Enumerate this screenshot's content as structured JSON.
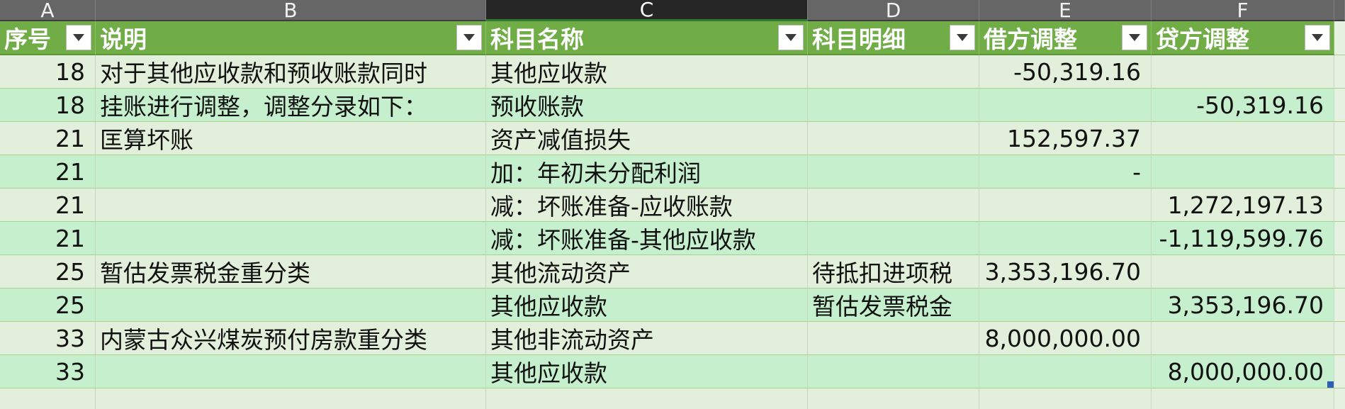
{
  "columns": [
    "A",
    "B",
    "C",
    "D",
    "E",
    "F"
  ],
  "active_column": "C",
  "table_headers": [
    "序号",
    "说明",
    "科目名称",
    "科目明细",
    "借方调整",
    "贷方调整"
  ],
  "rows": [
    {
      "seq": "18",
      "desc": "对于其他应收款和预收账款同时",
      "account": "其他应收款",
      "detail": "",
      "debit": "-50,319.16",
      "credit": ""
    },
    {
      "seq": "18",
      "desc": "挂账进行调整，调整分录如下：",
      "account": "预收账款",
      "detail": "",
      "debit": "",
      "credit": "-50,319.16"
    },
    {
      "seq": "21",
      "desc": "匡算坏账",
      "account": "资产减值损失",
      "detail": "",
      "debit": "152,597.37",
      "credit": ""
    },
    {
      "seq": "21",
      "desc": "",
      "account": "加：年初未分配利润",
      "detail": "",
      "debit": "-",
      "credit": ""
    },
    {
      "seq": "21",
      "desc": "",
      "account": "减：坏账准备-应收账款",
      "detail": "",
      "debit": "",
      "credit": "1,272,197.13"
    },
    {
      "seq": "21",
      "desc": "",
      "account": "减：坏账准备-其他应收款",
      "detail": "",
      "debit": "",
      "credit": "-1,119,599.76"
    },
    {
      "seq": "25",
      "desc": "暂估发票税金重分类",
      "account": "其他流动资产",
      "detail": "待抵扣进项税",
      "debit": "3,353,196.70",
      "credit": ""
    },
    {
      "seq": "25",
      "desc": "",
      "account": "其他应收款",
      "detail": "暂估发票税金",
      "debit": "",
      "credit": "3,353,196.70"
    },
    {
      "seq": "33",
      "desc": "内蒙古众兴煤炭预付房款重分类",
      "account": "其他非流动资产",
      "detail": "",
      "debit": "8,000,000.00",
      "credit": ""
    },
    {
      "seq": "33",
      "desc": "",
      "account": "其他应收款",
      "detail": "",
      "debit": "",
      "credit": "8,000,000.00"
    }
  ],
  "icons": {
    "filter": "chevron-down-icon",
    "resize": "table-resize-handle-icon"
  },
  "colors": {
    "header_green": "#70ad47",
    "band_light": "#e2efda",
    "band_dark": "#c6efce",
    "column_header_gray": "#666666",
    "active_column_header": "#262626"
  }
}
